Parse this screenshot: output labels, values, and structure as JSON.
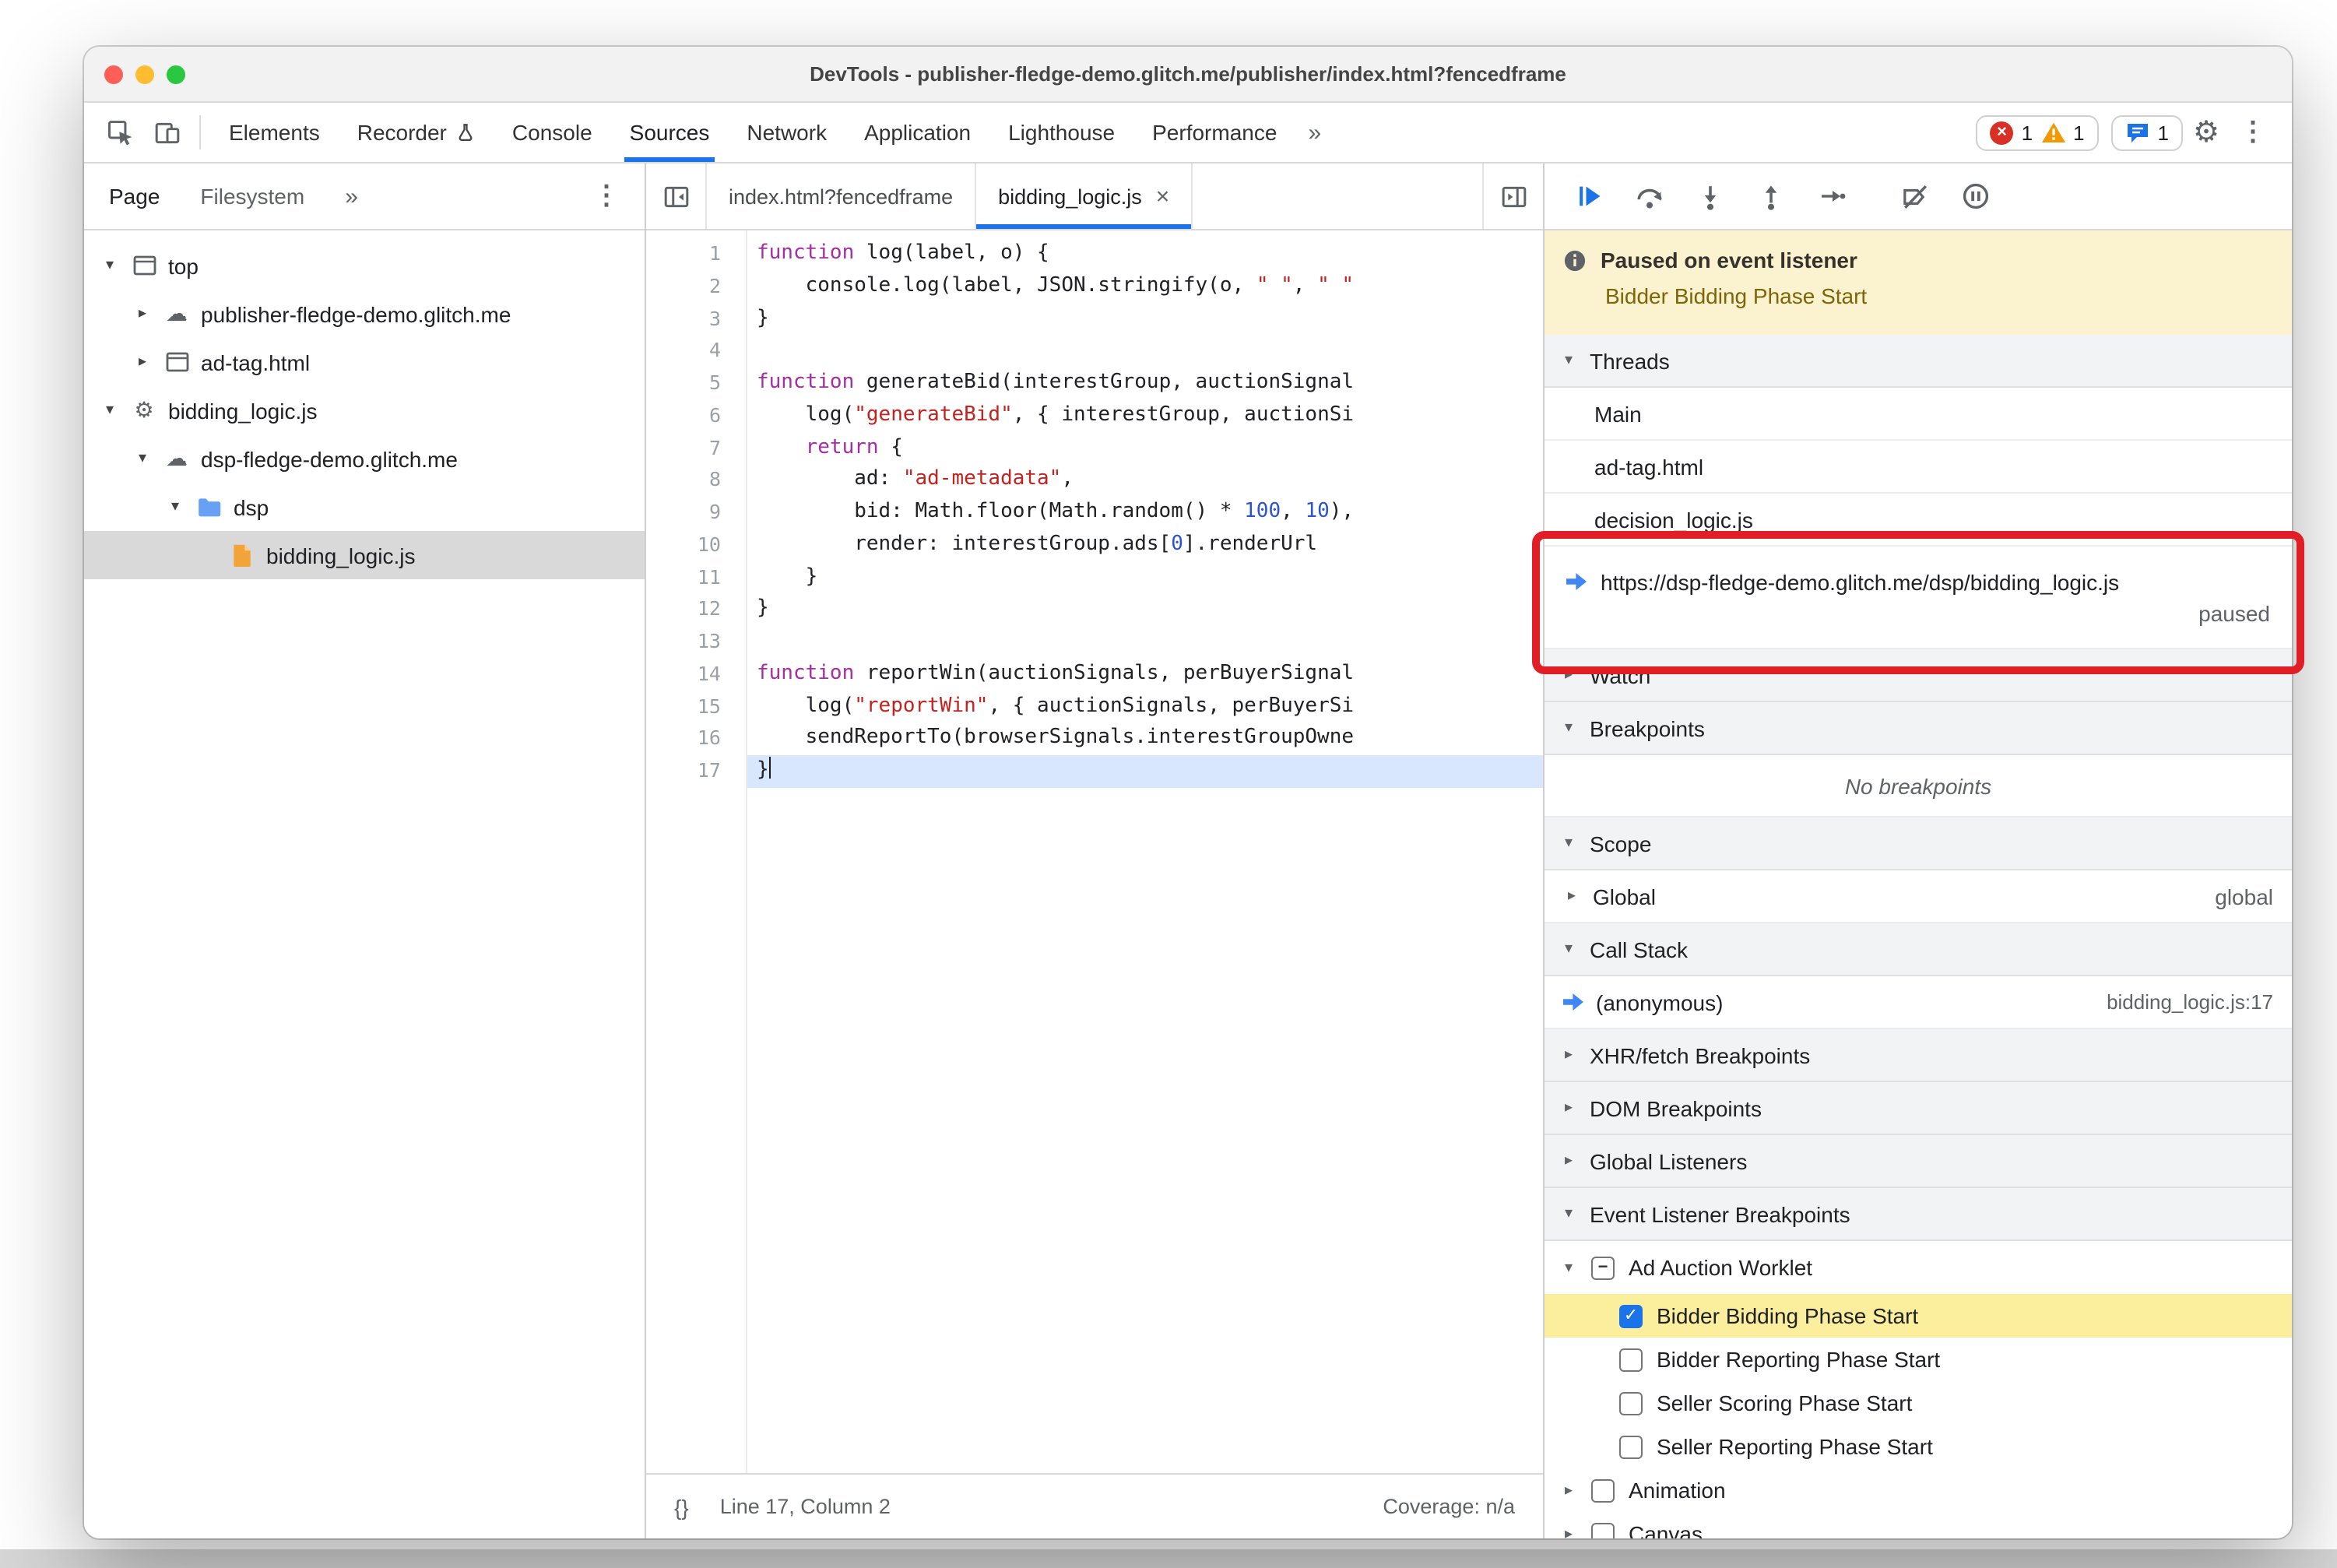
{
  "window": {
    "title": "DevTools - publisher-fledge-demo.glitch.me/publisher/index.html?fencedframe"
  },
  "toolbar": {
    "tabs": [
      {
        "label": "Elements"
      },
      {
        "label": "Recorder",
        "icon": "flask-icon"
      },
      {
        "label": "Console"
      },
      {
        "label": "Sources",
        "active": true
      },
      {
        "label": "Network"
      },
      {
        "label": "Application"
      },
      {
        "label": "Lighthouse"
      },
      {
        "label": "Performance"
      }
    ],
    "more_label": "»",
    "kebab": "⋮",
    "errors": "1",
    "warnings": "1",
    "issues": "1"
  },
  "navigator": {
    "tabs": [
      {
        "label": "Page",
        "active": true
      },
      {
        "label": "Filesystem"
      }
    ],
    "more_label": "»",
    "kebab": "⋮",
    "tree": [
      {
        "label": "top",
        "icon": "frame",
        "depth": 0,
        "arrow": "expanded"
      },
      {
        "label": "publisher-fledge-demo.glitch.me",
        "icon": "cloud",
        "depth": 1,
        "arrow": "collapsed"
      },
      {
        "label": "ad-tag.html",
        "icon": "frame",
        "depth": 1,
        "arrow": "collapsed"
      },
      {
        "label": "bidding_logic.js",
        "icon": "worker",
        "depth": 0,
        "arrow": "expanded"
      },
      {
        "label": "dsp-fledge-demo.glitch.me",
        "icon": "cloud",
        "depth": 1,
        "arrow": "expanded"
      },
      {
        "label": "dsp",
        "icon": "folder",
        "depth": 2,
        "arrow": "expanded"
      },
      {
        "label": "bidding_logic.js",
        "icon": "file",
        "depth": 3,
        "arrow": "none",
        "selected": true
      }
    ]
  },
  "editor": {
    "tabs": [
      {
        "label": "index.html?fencedframe"
      },
      {
        "label": "bidding_logic.js",
        "active": true,
        "close": "×"
      }
    ],
    "highlight_line": 17,
    "lines": [
      {
        "n": 1,
        "toks": [
          [
            "k",
            "function"
          ],
          [
            "p",
            " log(label, o) {"
          ]
        ]
      },
      {
        "n": 2,
        "toks": [
          [
            "p",
            "    console.log(label, JSON.stringify(o, "
          ],
          [
            "s",
            "\" \""
          ],
          [
            "p",
            ", "
          ],
          [
            "s",
            "\" \""
          ]
        ]
      },
      {
        "n": 3,
        "toks": [
          [
            "p",
            "}"
          ]
        ]
      },
      {
        "n": 4,
        "toks": []
      },
      {
        "n": 5,
        "toks": [
          [
            "k",
            "function"
          ],
          [
            "p",
            " generateBid(interestGroup, auctionSignal"
          ]
        ]
      },
      {
        "n": 6,
        "toks": [
          [
            "p",
            "    log("
          ],
          [
            "s",
            "\"generateBid\""
          ],
          [
            "p",
            ", { interestGroup, auctionSi"
          ]
        ]
      },
      {
        "n": 7,
        "toks": [
          [
            "p",
            "    "
          ],
          [
            "k",
            "return"
          ],
          [
            "p",
            " {"
          ]
        ]
      },
      {
        "n": 8,
        "toks": [
          [
            "p",
            "        ad: "
          ],
          [
            "s",
            "\"ad-metadata\""
          ],
          [
            "p",
            ","
          ]
        ]
      },
      {
        "n": 9,
        "toks": [
          [
            "p",
            "        bid: Math.floor(Math.random() * "
          ],
          [
            "n",
            "100"
          ],
          [
            "p",
            ", "
          ],
          [
            "n",
            "10"
          ],
          [
            "p",
            "),"
          ]
        ]
      },
      {
        "n": 10,
        "toks": [
          [
            "p",
            "        render: interestGroup.ads["
          ],
          [
            "n",
            "0"
          ],
          [
            "p",
            "].renderUrl"
          ]
        ]
      },
      {
        "n": 11,
        "toks": [
          [
            "p",
            "    }"
          ]
        ]
      },
      {
        "n": 12,
        "toks": [
          [
            "p",
            "}"
          ]
        ]
      },
      {
        "n": 13,
        "toks": []
      },
      {
        "n": 14,
        "toks": [
          [
            "k",
            "function"
          ],
          [
            "p",
            " reportWin(auctionSignals, perBuyerSignal"
          ]
        ]
      },
      {
        "n": 15,
        "toks": [
          [
            "p",
            "    log("
          ],
          [
            "s",
            "\"reportWin\""
          ],
          [
            "p",
            ", { auctionSignals, perBuyerSi"
          ]
        ]
      },
      {
        "n": 16,
        "toks": [
          [
            "p",
            "    sendReportTo(browserSignals.interestGroupOwne"
          ]
        ]
      },
      {
        "n": 17,
        "toks": [
          [
            "p",
            "}"
          ]
        ],
        "cursor": true
      }
    ],
    "status": {
      "braces": "{}",
      "line_col": "Line 17, Column 2",
      "coverage": "Coverage: n/a"
    }
  },
  "debugger": {
    "toolbar_icons": [
      "resume-icon",
      "step-over-icon",
      "step-into-icon",
      "step-out-icon",
      "step-icon",
      "deactivate-breakpoints-icon",
      "pause-on-exceptions-icon"
    ],
    "paused_banner": {
      "title": "Paused on event listener",
      "subtitle": "Bidder Bidding Phase Start"
    },
    "threads": {
      "title": "Threads",
      "items": [
        {
          "label": "Main"
        },
        {
          "label": "ad-tag.html"
        },
        {
          "label": "decision_logic.js"
        },
        {
          "label": "https://dsp-fledge-demo.glitch.me/dsp/bidding_logic.js",
          "status": "paused",
          "current": true
        }
      ]
    },
    "watch": {
      "title": "Watch"
    },
    "breakpoints": {
      "title": "Breakpoints",
      "empty": "No breakpoints"
    },
    "scope": {
      "title": "Scope",
      "rows": [
        {
          "label": "Global",
          "value": "global"
        }
      ]
    },
    "call_stack": {
      "title": "Call Stack",
      "frames": [
        {
          "label": "(anonymous)",
          "location": "bidding_logic.js:17"
        }
      ]
    },
    "xhr_breakpoints": {
      "title": "XHR/fetch Breakpoints"
    },
    "dom_breakpoints": {
      "title": "DOM Breakpoints"
    },
    "global_listeners": {
      "title": "Global Listeners"
    },
    "event_listener_breakpoints": {
      "title": "Event Listener Breakpoints",
      "groups": [
        {
          "label": "Ad Auction Worklet",
          "checkbox": "indeterminate",
          "expanded": true,
          "children": [
            {
              "label": "Bidder Bidding Phase Start",
              "checked": true,
              "highlighted": true
            },
            {
              "label": "Bidder Reporting Phase Start",
              "checked": false
            },
            {
              "label": "Seller Scoring Phase Start",
              "checked": false
            },
            {
              "label": "Seller Reporting Phase Start",
              "checked": false
            }
          ]
        },
        {
          "label": "Animation",
          "checkbox": "unchecked",
          "expanded": false,
          "children": []
        },
        {
          "label": "Canvas",
          "checkbox": "unchecked",
          "expanded": false,
          "children": []
        }
      ]
    }
  },
  "colors": {
    "accent": "#1a73e8",
    "error": "#d93025",
    "warning": "#f29900",
    "paused_banner_bg": "#fbf2cf",
    "breakpoint_highlight": "#fbee9c",
    "selection_line": "#d8e7fd",
    "annotation": "#e11e25",
    "syntax_keyword": "#a42ea2",
    "syntax_string": "#c5221f",
    "syntax_number": "#2a53cd"
  }
}
